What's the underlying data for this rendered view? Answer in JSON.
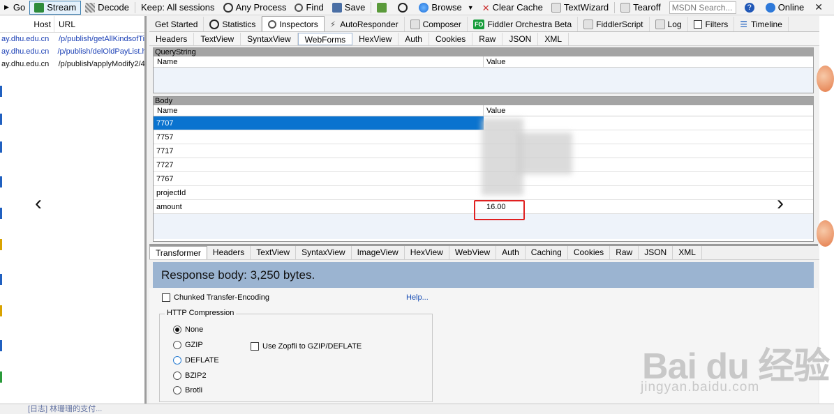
{
  "toolbar": {
    "go": "Go",
    "stream": "Stream",
    "decode": "Decode",
    "keep": "Keep: All sessions",
    "any_process": "Any Process",
    "find": "Find",
    "save": "Save",
    "browse": "Browse",
    "clear_cache": "Clear Cache",
    "textwizard": "TextWizard",
    "tearoff": "Tearoff",
    "search_placeholder": "MSDN Search...",
    "online": "Online"
  },
  "sessions": {
    "header_host": "Host",
    "header_url": "URL",
    "rows": [
      {
        "host": "ay.dhu.edu.cn",
        "url": "/p/publish/getAllKindsofTi"
      },
      {
        "host": "ay.dhu.edu.cn",
        "url": "/p/publish/delOldPayList.h"
      },
      {
        "host": "ay.dhu.edu.cn",
        "url": "/p/publish/applyModify2/4"
      }
    ]
  },
  "inspector_tabs": [
    "Get Started",
    "Statistics",
    "Inspectors",
    "AutoResponder",
    "Composer",
    "Fiddler Orchestra Beta",
    "FiddlerScript",
    "Log",
    "Filters",
    "Timeline"
  ],
  "fo_badge": "FO",
  "request_tabs": [
    "Headers",
    "TextView",
    "SyntaxView",
    "WebForms",
    "HexView",
    "Auth",
    "Cookies",
    "Raw",
    "JSON",
    "XML"
  ],
  "querystring": {
    "title": "QueryString",
    "col_name": "Name",
    "col_value": "Value"
  },
  "body": {
    "title": "Body",
    "col_name": "Name",
    "col_value": "Value",
    "rows": [
      {
        "name": "7707",
        "value": ""
      },
      {
        "name": "7757",
        "value": ""
      },
      {
        "name": "7717",
        "value": ""
      },
      {
        "name": "7727",
        "value": ""
      },
      {
        "name": "7767",
        "value": ""
      },
      {
        "name": "projectId",
        "value": ""
      },
      {
        "name": "amount",
        "value": "16.00"
      }
    ]
  },
  "response_tabs": [
    "Transformer",
    "Headers",
    "TextView",
    "SyntaxView",
    "ImageView",
    "HexView",
    "WebView",
    "Auth",
    "Caching",
    "Cookies",
    "Raw",
    "JSON",
    "XML"
  ],
  "response": {
    "body_text": "Response body: 3,250 bytes.",
    "chunked_label": "Chunked Transfer-Encoding",
    "help_link": "Help...",
    "compression_title": "HTTP Compression",
    "options": [
      "None",
      "GZIP",
      "DEFLATE",
      "BZIP2",
      "Brotli"
    ],
    "selected": "None",
    "zopfli_label": "Use Zopfli to GZIP/DEFLATE"
  },
  "status": {
    "text": "[日志] 林珊珊的支付..."
  },
  "watermark": {
    "brand": "Bai du 经验",
    "url": "jingyan.baidu.com"
  },
  "colors": {
    "selected_row": "#0a73cf",
    "highlight_border": "#e02020",
    "response_banner": "#9bb4d1",
    "link": "#1a4fb5"
  }
}
